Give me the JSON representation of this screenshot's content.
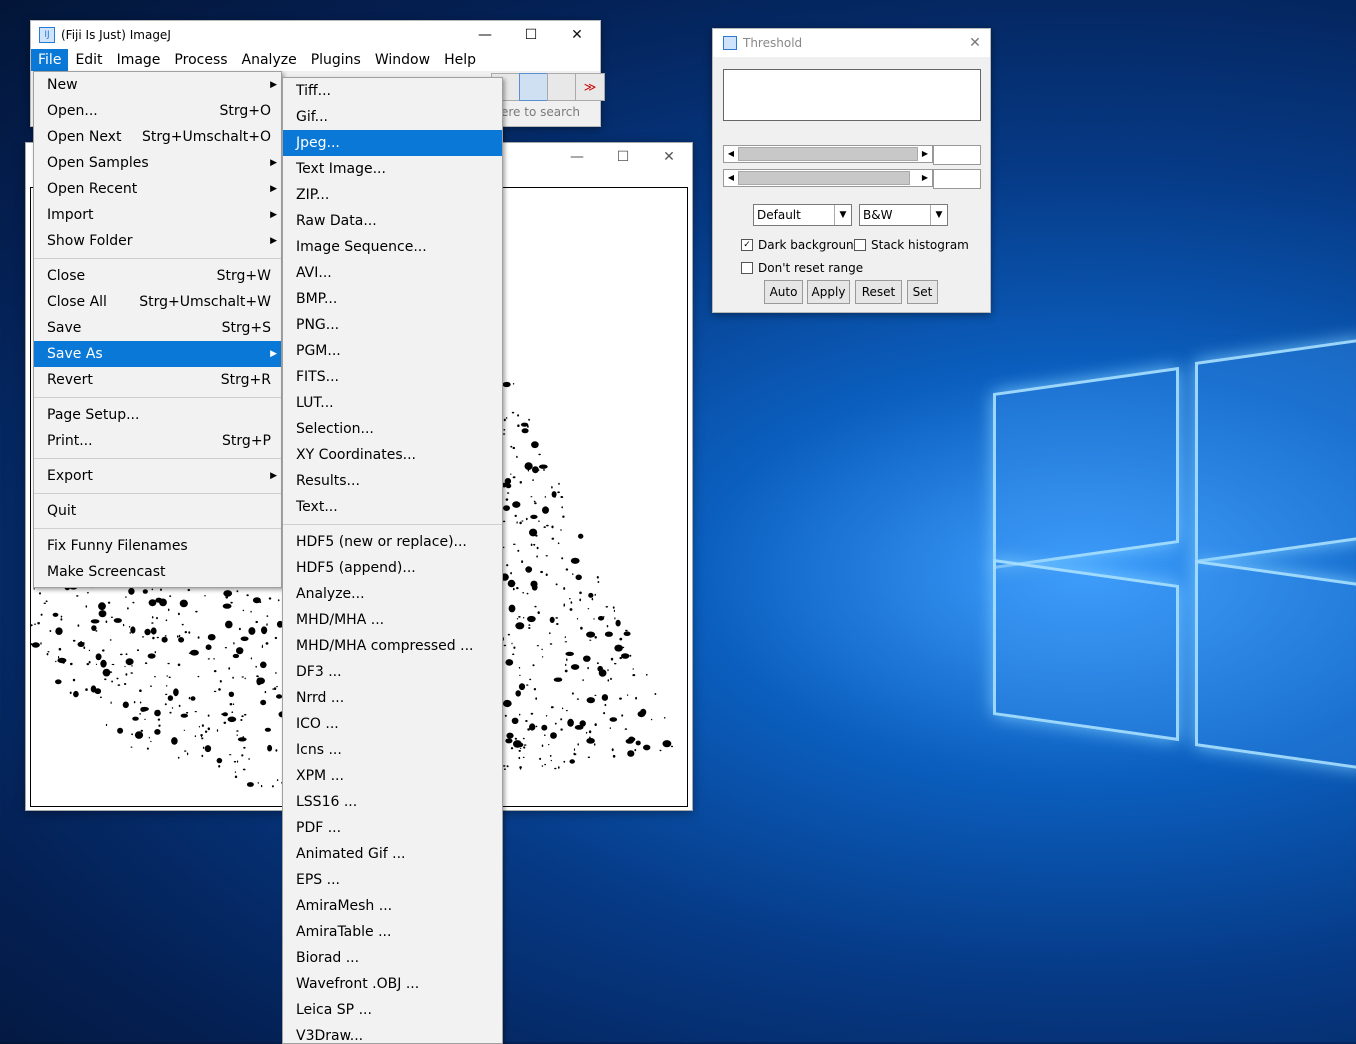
{
  "main_window": {
    "title": "(Fiji Is Just) ImageJ",
    "minimize": "—",
    "maximize": "☐",
    "close": "✕",
    "menus": [
      "File",
      "Edit",
      "Image",
      "Process",
      "Analyze",
      "Plugins",
      "Window",
      "Help"
    ],
    "search_hint": "ere to search",
    "more_tools": "≫"
  },
  "image_window": {
    "minimize": "—",
    "maximize": "☐",
    "close": "✕"
  },
  "file_menu": [
    {
      "label": "New",
      "accel": "",
      "submenu": true
    },
    {
      "label": "Open...",
      "accel": "Strg+O",
      "submenu": false
    },
    {
      "label": "Open Next",
      "accel": "Strg+Umschalt+O",
      "submenu": false
    },
    {
      "label": "Open Samples",
      "accel": "",
      "submenu": true
    },
    {
      "label": "Open Recent",
      "accel": "",
      "submenu": true
    },
    {
      "label": "Import",
      "accel": "",
      "submenu": true
    },
    {
      "label": "Show Folder",
      "accel": "",
      "submenu": true
    },
    {
      "sep": true
    },
    {
      "label": "Close",
      "accel": "Strg+W",
      "submenu": false
    },
    {
      "label": "Close All",
      "accel": "Strg+Umschalt+W",
      "submenu": false
    },
    {
      "label": "Save",
      "accel": "Strg+S",
      "submenu": false
    },
    {
      "label": "Save As",
      "accel": "",
      "submenu": true,
      "selected": true
    },
    {
      "label": "Revert",
      "accel": "Strg+R",
      "submenu": false
    },
    {
      "sep": true
    },
    {
      "label": "Page Setup...",
      "accel": "",
      "submenu": false
    },
    {
      "label": "Print...",
      "accel": "Strg+P",
      "submenu": false
    },
    {
      "sep": true
    },
    {
      "label": "Export",
      "accel": "",
      "submenu": true
    },
    {
      "sep": true
    },
    {
      "label": "Quit",
      "accel": "",
      "submenu": false
    },
    {
      "sep": true
    },
    {
      "label": "Fix Funny Filenames",
      "accel": "",
      "submenu": false
    },
    {
      "label": "Make Screencast",
      "accel": "",
      "submenu": false
    }
  ],
  "save_as_menu": [
    {
      "label": "Tiff..."
    },
    {
      "label": "Gif..."
    },
    {
      "label": "Jpeg...",
      "selected": true
    },
    {
      "label": "Text Image..."
    },
    {
      "label": "ZIP..."
    },
    {
      "label": "Raw Data..."
    },
    {
      "label": "Image Sequence..."
    },
    {
      "label": "AVI..."
    },
    {
      "label": "BMP..."
    },
    {
      "label": "PNG..."
    },
    {
      "label": "PGM..."
    },
    {
      "label": "FITS..."
    },
    {
      "label": "LUT..."
    },
    {
      "label": "Selection..."
    },
    {
      "label": "XY Coordinates..."
    },
    {
      "label": "Results..."
    },
    {
      "label": "Text..."
    },
    {
      "sep": true
    },
    {
      "label": "HDF5 (new or replace)..."
    },
    {
      "label": "HDF5 (append)..."
    },
    {
      "label": "Analyze..."
    },
    {
      "label": "MHD/MHA ..."
    },
    {
      "label": "MHD/MHA compressed ..."
    },
    {
      "label": "DF3 ..."
    },
    {
      "label": "Nrrd ..."
    },
    {
      "label": "ICO ..."
    },
    {
      "label": "Icns ..."
    },
    {
      "label": "XPM ..."
    },
    {
      "label": "LSS16 ..."
    },
    {
      "label": "PDF ..."
    },
    {
      "label": "Animated Gif ..."
    },
    {
      "label": "EPS ..."
    },
    {
      "label": "AmiraMesh ..."
    },
    {
      "label": "AmiraTable ..."
    },
    {
      "label": "Biorad ..."
    },
    {
      "label": "Wavefront .OBJ ..."
    },
    {
      "label": "Leica SP ..."
    },
    {
      "label": "V3Draw..."
    }
  ],
  "threshold": {
    "title": "Threshold",
    "close": "✕",
    "method": "Default",
    "mode": "B&W",
    "dark_background": "Dark background",
    "dark_background_checked": true,
    "stack_histogram": "Stack histogram",
    "stack_histogram_checked": false,
    "dont_reset": "Don't reset range",
    "dont_reset_checked": false,
    "buttons": {
      "auto": "Auto",
      "apply": "Apply",
      "reset": "Reset",
      "set": "Set"
    }
  },
  "colors": {
    "accent": "#0a78d7",
    "menu_bg": "#f2f2f2"
  }
}
